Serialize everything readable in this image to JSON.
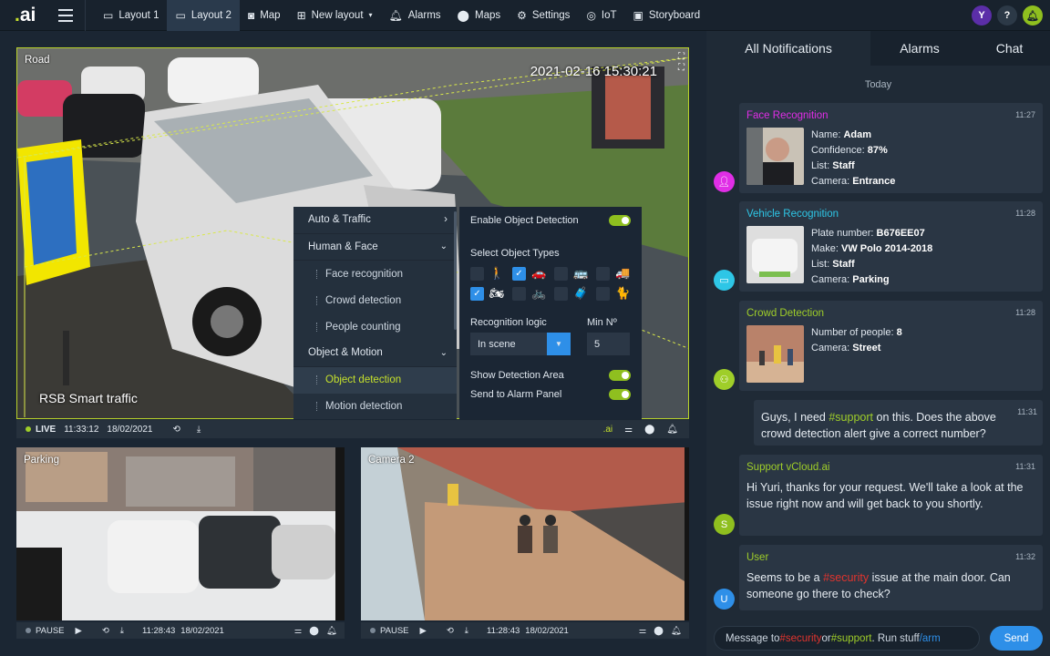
{
  "app": {
    "logo_dot": ".",
    "logo_text": "ai"
  },
  "nav": [
    {
      "label": "Layout 1",
      "icon": "layout-icon"
    },
    {
      "label": "Layout 2",
      "icon": "layout-icon"
    },
    {
      "label": "Map",
      "icon": "map-icon"
    },
    {
      "label": "New layout",
      "icon": "add-layout-icon"
    },
    {
      "label": "Alarms",
      "icon": "bell-icon"
    },
    {
      "label": "Maps",
      "icon": "pin-icon"
    },
    {
      "label": "Settings",
      "icon": "gear-icon"
    },
    {
      "label": "IoT",
      "icon": "globe-icon"
    },
    {
      "label": "Storyboard",
      "icon": "storyboard-icon"
    }
  ],
  "user": {
    "initial": "Y",
    "help": "?"
  },
  "main_camera": {
    "name": "Road",
    "timestamp": "2021-02-16 15:30:21",
    "overlay_text": "RSB Smart traffic",
    "status": "LIVE",
    "time": "11:33:12",
    "date": "18/02/2021",
    "ai_label": ".ai"
  },
  "menu": {
    "auto_traffic": "Auto & Traffic",
    "human_face": "Human & Face",
    "face_recognition": "Face recognition",
    "crowd_detection": "Crowd detection",
    "people_counting": "People counting",
    "object_motion": "Object & Motion",
    "object_detection": "Object detection",
    "motion_detection": "Motion detection"
  },
  "detection_panel": {
    "enable_label": "Enable Object Detection",
    "enabled": true,
    "select_types_label": "Select Object Types",
    "object_types": [
      {
        "name": "pedestrian",
        "glyph": "🚶",
        "checked": false
      },
      {
        "name": "car",
        "glyph": "🚗",
        "checked": true
      },
      {
        "name": "bus",
        "glyph": "🚌",
        "checked": false
      },
      {
        "name": "truck",
        "glyph": "🚚",
        "checked": false
      },
      {
        "name": "motorcycle",
        "glyph": "🏍",
        "checked": true
      },
      {
        "name": "bicycle",
        "glyph": "🚲",
        "checked": false
      },
      {
        "name": "luggage",
        "glyph": "🧳",
        "checked": false
      },
      {
        "name": "animal",
        "glyph": "🐈",
        "checked": false
      }
    ],
    "logic_label": "Recognition logic",
    "logic_value": "In scene",
    "min_label": "Min Nº",
    "min_value": "5",
    "show_area_label": "Show Detection Area",
    "show_area": true,
    "send_alarm_label": "Send to Alarm Panel",
    "send_alarm": true
  },
  "small_cams": [
    {
      "name": "Parking",
      "status": "PAUSE",
      "time": "11:28:43",
      "date": "18/02/2021"
    },
    {
      "name": "Camera 2",
      "status": "PAUSE",
      "time": "11:28:43",
      "date": "18/02/2021"
    }
  ],
  "sidebar": {
    "tabs": [
      "All Notifications",
      "Alarms",
      "Chat"
    ],
    "day": "Today",
    "face": {
      "title": "Face Recognition",
      "time": "11:27",
      "fields": [
        {
          "k": "Name: ",
          "v": "Adam"
        },
        {
          "k": "Confidence: ",
          "v": "87%"
        },
        {
          "k": "List: ",
          "v": "Staff"
        },
        {
          "k": "Camera: ",
          "v": "Entrance"
        }
      ]
    },
    "vehicle": {
      "title": "Vehicle Recognition",
      "time": "11:28",
      "fields": [
        {
          "k": "Plate number: ",
          "v": "B676EE07"
        },
        {
          "k": "Make: ",
          "v": "VW Polo 2014-2018"
        },
        {
          "k": "List: ",
          "v": "Staff"
        },
        {
          "k": "Camera: ",
          "v": "Parking"
        }
      ]
    },
    "crowd": {
      "title": "Crowd Detection",
      "time": "11:28",
      "fields": [
        {
          "k": "Number of people: ",
          "v": "8"
        },
        {
          "k": "Camera: ",
          "v": "Street"
        }
      ]
    },
    "my_message": {
      "pre": "Guys, I need ",
      "tag": "#support",
      "post": " on this. Does the above crowd detection alert give a correct number?",
      "time": "11:31"
    },
    "support": {
      "author": "Support vCloud.ai",
      "time": "11:31",
      "initial": "S",
      "text": "Hi Yuri, thanks for your request. We'll take a look at the issue right now and will get back to you shortly."
    },
    "user_msg": {
      "author": "User",
      "time": "11:32",
      "initial": "U",
      "pre": "Seems to be a ",
      "tag": "#security",
      "post": " issue at the main door. Can someone go there to check?"
    },
    "composer": {
      "pre": "Message to ",
      "tag1": "#security",
      "mid": " or ",
      "tag2": "#support",
      "mid2": ". Run stuff ",
      "cmd": "/arm"
    },
    "send_label": "Send"
  },
  "colors": {
    "accent": "#c5e02c",
    "blue": "#2e8fe8",
    "face": "#e02ee6",
    "vehicle": "#2ec6e6",
    "crowd": "#9fce29"
  }
}
